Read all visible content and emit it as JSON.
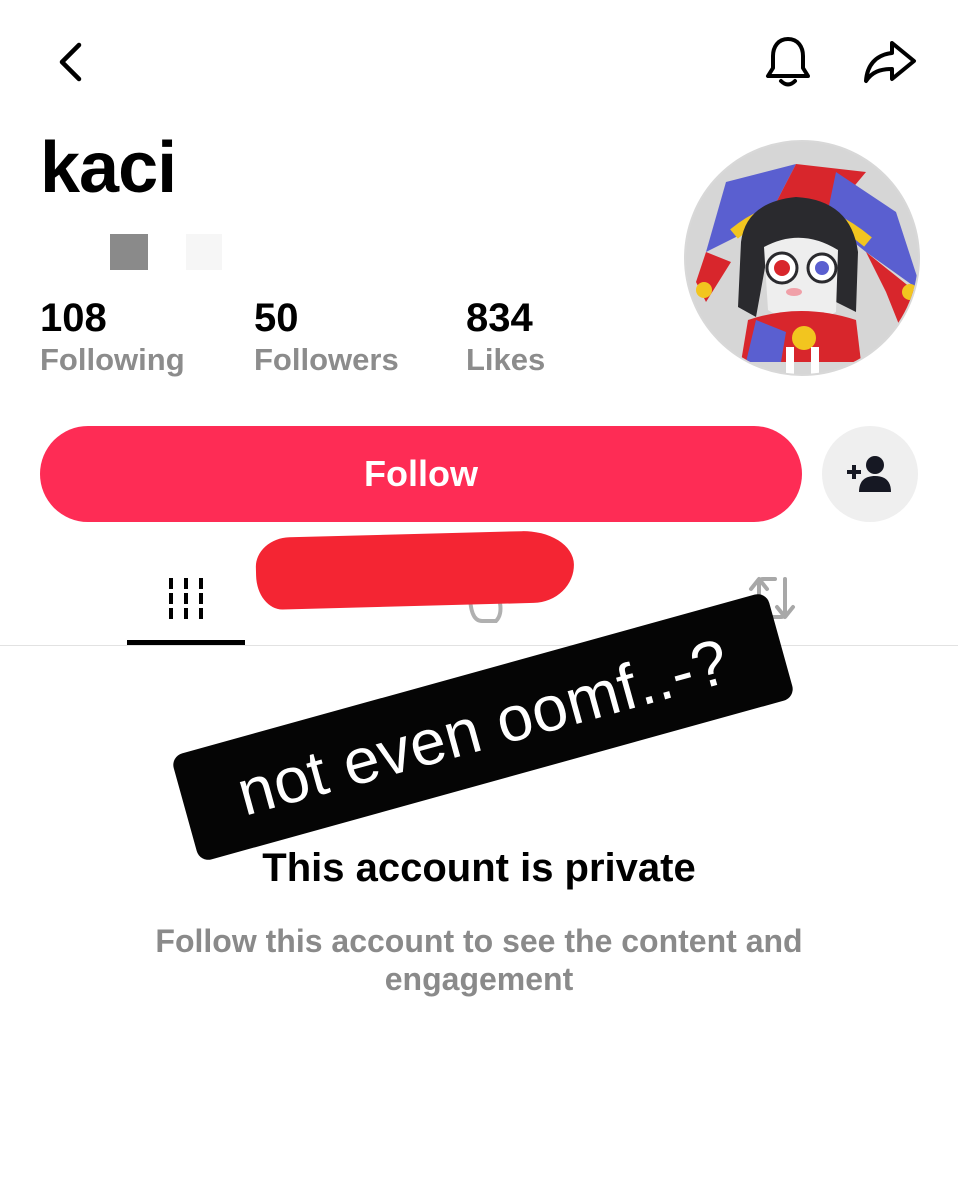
{
  "header": {
    "back_icon": "chevron-left-icon",
    "notification_icon": "bell-icon",
    "share_icon": "share-arrow-icon"
  },
  "profile": {
    "username": "kaci",
    "stats": [
      {
        "value": "108",
        "label": "Following"
      },
      {
        "value": "50",
        "label": "Followers"
      },
      {
        "value": "834",
        "label": "Likes"
      }
    ]
  },
  "actions": {
    "follow_label": "Follow",
    "follow_color": "#fe2c55",
    "add_friend_icon": "add-user-icon"
  },
  "tabs": [
    {
      "icon": "grid-icon",
      "active": true
    },
    {
      "icon": "liked-icon",
      "active": false
    },
    {
      "icon": "repost-icon",
      "active": false
    }
  ],
  "sticker": {
    "text": "not even oomf..-?"
  },
  "private": {
    "title": "This account is private",
    "subtitle": "Follow this account to see the content and engagement"
  }
}
